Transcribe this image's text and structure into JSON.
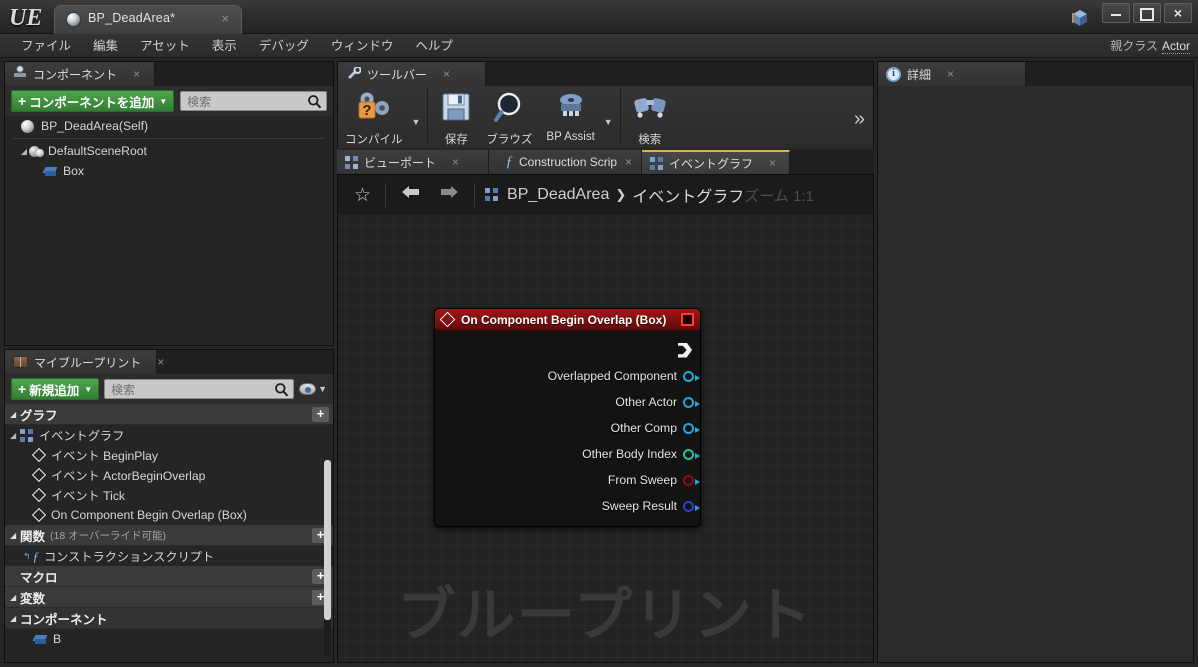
{
  "window": {
    "logo": "UE",
    "asset_tab": {
      "title": "BP_DeadArea*",
      "close": "×",
      "icon": "sphere-icon"
    },
    "controls": {
      "minimize": "minimize-icon",
      "maximize": "maximize-icon",
      "close": "×"
    }
  },
  "menu": {
    "items": [
      "ファイル",
      "編集",
      "アセット",
      "表示",
      "デバッグ",
      "ウィンドウ",
      "ヘルプ"
    ],
    "parent_class_label": "親クラス",
    "parent_class_value": "Actor"
  },
  "components_panel": {
    "tab_label": "コンポーネント",
    "tab_icon": "components-icon",
    "tab_close": "×",
    "add_button": {
      "plus": "+",
      "label": "コンポーネントを追加",
      "caret": "▼"
    },
    "search": {
      "placeholder": "検索",
      "icon": "search-icon"
    },
    "tree": [
      {
        "label": "BP_DeadArea(Self)",
        "icon": "sphere-icon",
        "indent": 0,
        "arrow": ""
      },
      {
        "label": "DefaultSceneRoot",
        "icon": "scene-root-icon",
        "indent": 1,
        "arrow": "◢"
      },
      {
        "label": "Box",
        "icon": "box-icon",
        "indent": 2,
        "arrow": ""
      }
    ]
  },
  "myblueprint_panel": {
    "tab_label": "マイブループリント",
    "tab_icon": "book-icon",
    "tab_close": "×",
    "add_button": {
      "plus": "+",
      "label": "新規追加",
      "caret": "▼"
    },
    "search": {
      "placeholder": "検索",
      "icon": "search-icon"
    },
    "eye_button": {
      "icon": "eye-icon",
      "caret": "▼"
    },
    "sections": [
      {
        "name": "グラフ",
        "sub": "",
        "arrow": "◢",
        "plus": "+",
        "items": [
          {
            "label": "イベントグラフ",
            "icon": "event-graph-icon",
            "indent": 1,
            "arrow": "◢"
          },
          {
            "label": "イベント BeginPlay",
            "icon": "diamond-icon",
            "indent": 2,
            "arrow": ""
          },
          {
            "label": "イベント ActorBeginOverlap",
            "icon": "diamond-icon",
            "indent": 2,
            "arrow": ""
          },
          {
            "label": "イベント Tick",
            "icon": "diamond-icon",
            "indent": 2,
            "arrow": ""
          },
          {
            "label": "On Component Begin Overlap (Box)",
            "icon": "diamond-icon",
            "indent": 2,
            "arrow": ""
          }
        ]
      },
      {
        "name": "関数",
        "sub": "(18 オーバーライド可能)",
        "arrow": "◢",
        "plus": "+",
        "items": [
          {
            "label": "コンストラクションスクリプト",
            "icon": "function-icon",
            "indent": 1,
            "arrow": ""
          }
        ]
      },
      {
        "name": "マクロ",
        "sub": "",
        "arrow": "",
        "plus": "+",
        "items": []
      },
      {
        "name": "変数",
        "sub": "",
        "arrow": "◢",
        "plus": "+",
        "items": []
      },
      {
        "name": "コンポーネント",
        "sub": "",
        "arrow": "◢",
        "plus": "",
        "items": [
          {
            "label": "B",
            "icon": "box-icon",
            "indent": 1,
            "arrow": ""
          }
        ]
      }
    ]
  },
  "toolbar_panel": {
    "tab_label": "ツールバー",
    "tab_icon": "wrench-icon",
    "tab_close": "×",
    "buttons": [
      {
        "label": "コンパイル",
        "icon": "compile-icon",
        "has_caret": true
      },
      {
        "label": "保存",
        "icon": "save-icon",
        "has_caret": false
      },
      {
        "label": "ブラウズ",
        "icon": "browse-icon",
        "has_caret": false
      },
      {
        "label": "BP Assist",
        "icon": "bp-assist-icon",
        "has_caret": true
      },
      {
        "label": "検索",
        "icon": "find-icon",
        "has_caret": false
      }
    ],
    "overflow": "»"
  },
  "graph_tabs": [
    {
      "label": "ビューポート",
      "icon": "viewport-icon",
      "close": "×",
      "active": false
    },
    {
      "label": "Construction Scrip",
      "icon": "function-icon",
      "close": "×",
      "active": false
    },
    {
      "label": "イベントグラフ",
      "icon": "event-graph-icon",
      "close": "×",
      "active": true
    }
  ],
  "graph": {
    "breadcrumb": {
      "star": "☆",
      "back": "←",
      "forward": "→",
      "icon": "event-graph-icon",
      "crumb1": "BP_DeadArea",
      "separator": "❯",
      "crumb2": "イベントグラフ"
    },
    "zoom_label": "ズーム 1:1",
    "watermark": "ブループリント",
    "node": {
      "title": "On Component Begin Overlap (Box)",
      "title_icon": "diamond-icon",
      "stop_icon": "breakpoint-icon",
      "header_color": "#8c1313",
      "exec_pin": {
        "name": "exec-out-pin",
        "color": "#f2f2f2"
      },
      "pins": [
        {
          "label": "Overlapped Component",
          "color": "#1fa8e0",
          "type": "object"
        },
        {
          "label": "Other Actor",
          "color": "#1fa8e0",
          "type": "object"
        },
        {
          "label": "Other Comp",
          "color": "#1fa8e0",
          "type": "object"
        },
        {
          "label": "Other Body Index",
          "color": "#22c98a",
          "type": "int"
        },
        {
          "label": "From Sweep",
          "color": "#8f0f0f",
          "type": "bool"
        },
        {
          "label": "Sweep Result",
          "color": "#2c3fd6",
          "type": "struct"
        }
      ]
    }
  },
  "details_panel": {
    "tab_label": "詳細",
    "tab_icon": "details-icon",
    "tab_close": "×"
  }
}
